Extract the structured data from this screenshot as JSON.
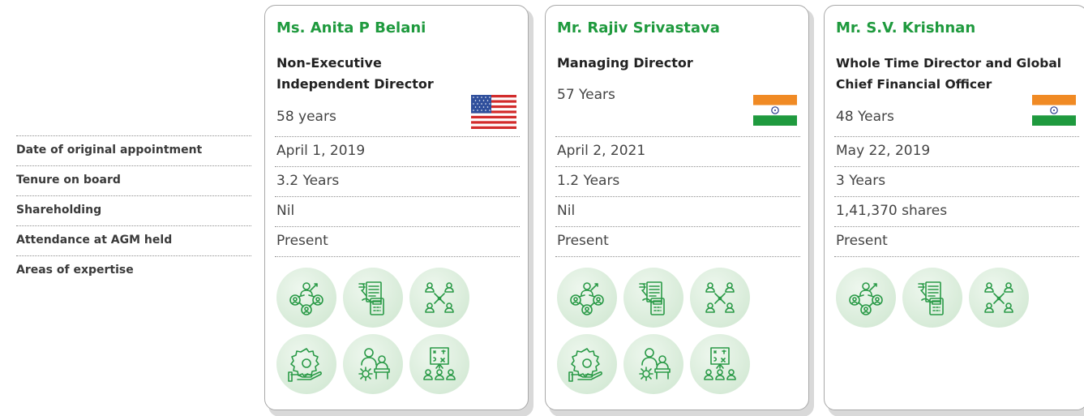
{
  "row_labels": [
    "Date of original appointment",
    "Tenure on board",
    "Shareholding",
    "Attendance at AGM held",
    "Areas of expertise"
  ],
  "directors": [
    {
      "name": "Ms. Anita P Belani",
      "role": "Non-Executive Independent Director",
      "age": "58 years",
      "flag": "usa-flag",
      "appointment": "April 1, 2019",
      "tenure": "3.2 Years",
      "shareholding": "Nil",
      "attendance": "Present",
      "expertise_icons": [
        "leadership-icon",
        "finance-calculator-icon",
        "network-icon",
        "operations-gear-icon",
        "governance-meeting-icon",
        "strategy-board-icon"
      ]
    },
    {
      "name": "Mr. Rajiv Srivastava",
      "role": "Managing Director",
      "age": "57 Years",
      "flag": "india-flag",
      "appointment": "April 2, 2021",
      "tenure": "1.2 Years",
      "shareholding": "Nil",
      "attendance": "Present",
      "expertise_icons": [
        "leadership-icon",
        "finance-calculator-icon",
        "network-icon",
        "operations-gear-icon",
        "governance-meeting-icon",
        "strategy-board-icon"
      ]
    },
    {
      "name": "Mr. S.V. Krishnan",
      "role": "Whole Time Director and Global Chief Financial Officer",
      "age": "48 Years",
      "flag": "india-flag",
      "appointment": "May 22, 2019",
      "tenure": "3 Years",
      "shareholding": "1,41,370 shares",
      "attendance": "Present",
      "expertise_icons": [
        "leadership-icon",
        "finance-calculator-icon",
        "network-icon"
      ]
    }
  ],
  "colors": {
    "name_green": "#1f9a3e",
    "icon_stroke": "#2a9a47",
    "icon_bg": "#dcedde"
  }
}
